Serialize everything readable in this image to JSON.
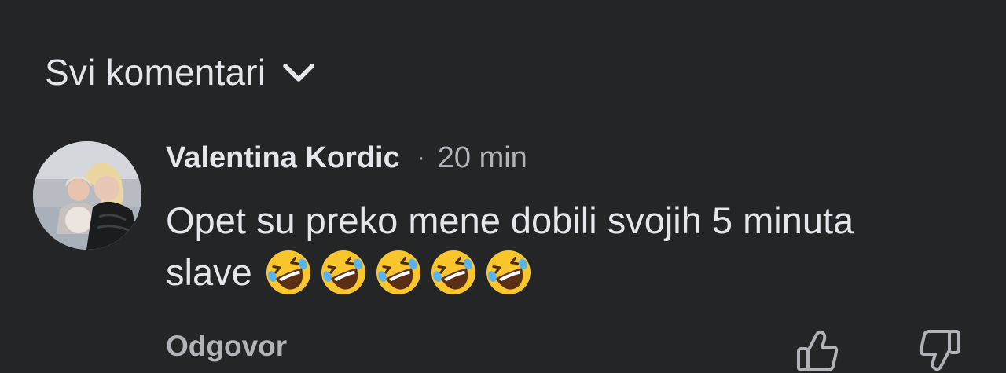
{
  "comments_section": {
    "sort_label": "Svi komentari",
    "sort_icon": "chevron-down-icon"
  },
  "comment": {
    "author": "Valentina Kordic",
    "separator": "·",
    "time": "20 min",
    "text": "Opet su preko mene dobili svojih 5 minuta slave",
    "emoji": [
      "🤣",
      "🤣",
      "🤣",
      "🤣",
      "🤣"
    ],
    "reply_label": "Odgovor",
    "like_icon": "thumbs-up-icon",
    "dislike_icon": "thumbs-down-icon"
  },
  "colors": {
    "background": "#242527",
    "primary_text": "#e4e6eb",
    "secondary_text": "#b0b3b8",
    "emoji_yellow": "#f9c62d",
    "tear_blue": "#58b3ef"
  }
}
